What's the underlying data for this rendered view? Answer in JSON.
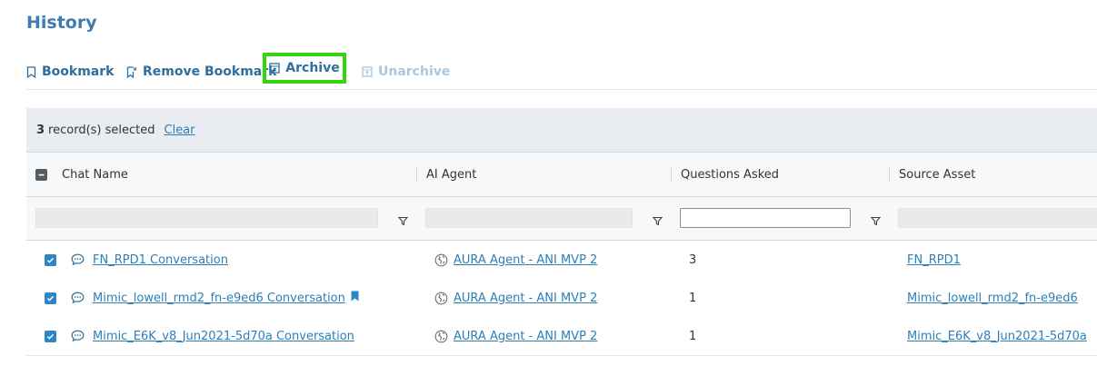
{
  "page": {
    "title": "History"
  },
  "toolbar": {
    "bookmark_label": "Bookmark",
    "remove_bookmark_label": "Remove Bookmark",
    "archive_label": "Archive",
    "unarchive_label": "Unarchive"
  },
  "selection": {
    "count": "3",
    "text": "record(s) selected",
    "clear_label": "Clear"
  },
  "columns": {
    "chat_name": "Chat Name",
    "ai_agent": "AI Agent",
    "questions_asked": "Questions Asked",
    "source_asset": "Source Asset"
  },
  "filters": {
    "questions_asked_value": ""
  },
  "rows": [
    {
      "checked": true,
      "chat_name": "FN_RPD1 Conversation",
      "bookmarked": false,
      "ai_agent": "AURA Agent - ANI MVP 2",
      "questions": "3",
      "source_asset": "FN_RPD1"
    },
    {
      "checked": true,
      "chat_name": "Mimic_lowell_rmd2_fn-e9ed6 Conversation",
      "bookmarked": true,
      "ai_agent": "AURA Agent - ANI MVP 2",
      "questions": "1",
      "source_asset": "Mimic_lowell_rmd2_fn-e9ed6"
    },
    {
      "checked": true,
      "chat_name": "Mimic_E6K_v8_Jun2021-5d70a Conversation",
      "bookmarked": false,
      "ai_agent": "AURA Agent - ANI MVP 2",
      "questions": "1",
      "source_asset": "Mimic_E6K_v8_Jun2021-5d70a"
    }
  ],
  "colors": {
    "accent": "#2e7fb5",
    "title": "#3d7bb0",
    "highlight": "#33d611",
    "checkbox": "#2e86c7"
  },
  "icons": {
    "bookmark": "bookmark-outline-icon",
    "remove_bookmark": "bookmark-remove-icon",
    "archive": "archive-icon",
    "unarchive": "unarchive-icon",
    "chat": "chat-bubble-icon",
    "agent": "agent-globe-icon",
    "filter": "filter-icon"
  }
}
